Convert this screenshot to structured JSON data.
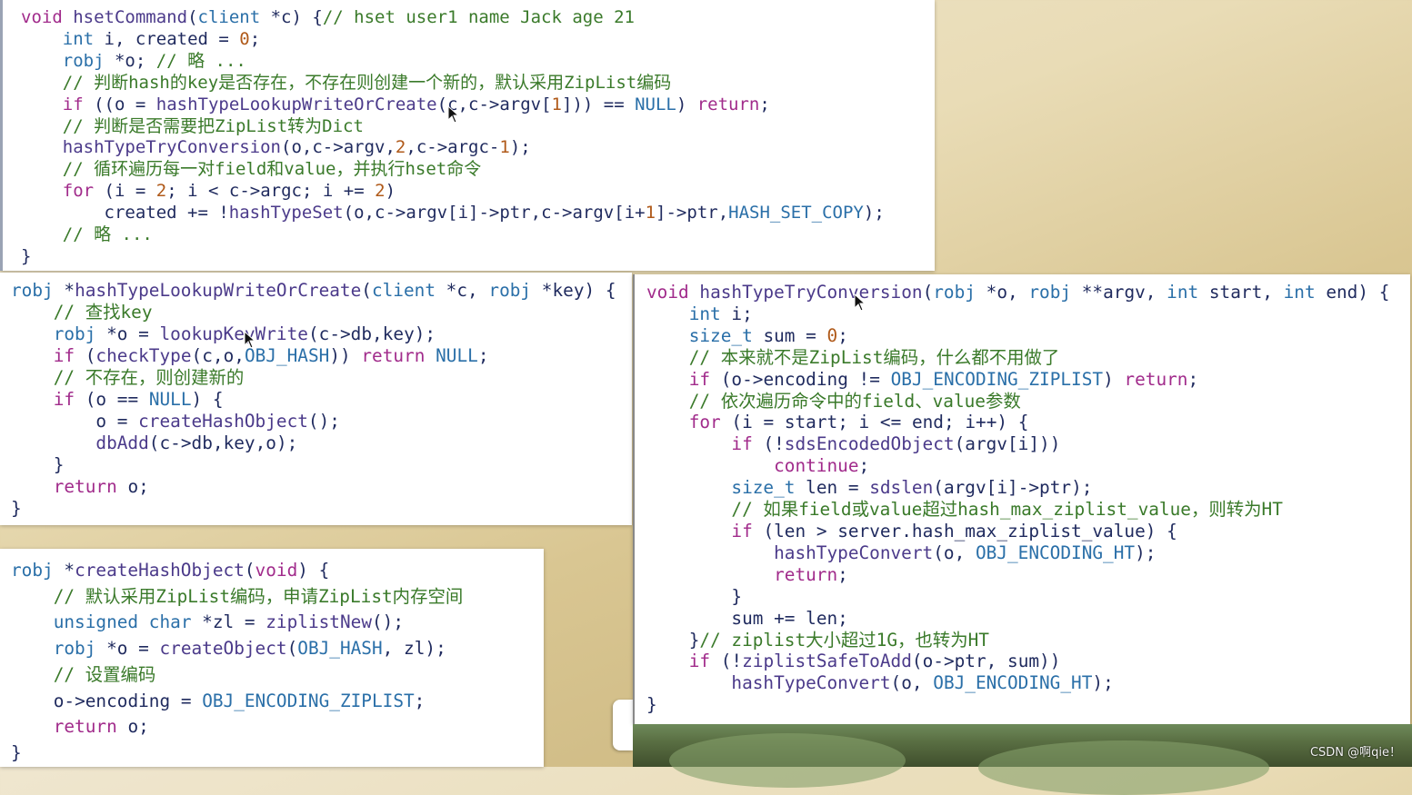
{
  "panels": {
    "hsetCommand": [
      "void hsetCommand(client *c) {// hset user1 name Jack age 21",
      "    int i, created = 0;",
      "    robj *o; // 略 ...",
      "    // 判断hash的key是否存在，不存在则创建一个新的，默认采用ZipList编码",
      "    if ((o = hashTypeLookupWriteOrCreate(c,c->argv[1])) == NULL) return;",
      "    // 判断是否需要把ZipList转为Dict",
      "    hashTypeTryConversion(o,c->argv,2,c->argc-1);",
      "    // 循环遍历每一对field和value，并执行hset命令",
      "    for (i = 2; i < c->argc; i += 2)",
      "        created += !hashTypeSet(o,c->argv[i]->ptr,c->argv[i+1]->ptr,HASH_SET_COPY);",
      "    // 略 ...",
      "}"
    ],
    "lookupWriteOrCreate": [
      "robj *hashTypeLookupWriteOrCreate(client *c, robj *key) {",
      "    // 查找key",
      "    robj *o = lookupKeyWrite(c->db,key);",
      "    if (checkType(c,o,OBJ_HASH)) return NULL;",
      "    // 不存在，则创建新的",
      "    if (o == NULL) {",
      "        o = createHashObject();",
      "        dbAdd(c->db,key,o);",
      "    }",
      "    return o;",
      "}"
    ],
    "createHashObject": [
      "robj *createHashObject(void) {",
      "    // 默认采用ZipList编码，申请ZipList内存空间",
      "    unsigned char *zl = ziplistNew();",
      "    robj *o = createObject(OBJ_HASH, zl);",
      "    // 设置编码",
      "    o->encoding = OBJ_ENCODING_ZIPLIST;",
      "    return o;",
      "}"
    ],
    "tryConversion": [
      "void hashTypeTryConversion(robj *o, robj **argv, int start, int end) {",
      "    int i;",
      "    size_t sum = 0;",
      "    // 本来就不是ZipList编码，什么都不用做了",
      "    if (o->encoding != OBJ_ENCODING_ZIPLIST) return;",
      "    // 依次遍历命令中的field、value参数",
      "    for (i = start; i <= end; i++) {",
      "        if (!sdsEncodedObject(argv[i]))",
      "            continue;",
      "        size_t len = sdslen(argv[i]->ptr);",
      "        // 如果field或value超过hash_max_ziplist_value，则转为HT",
      "        if (len > server.hash_max_ziplist_value) {",
      "            hashTypeConvert(o, OBJ_ENCODING_HT);",
      "            return;",
      "        }",
      "        sum += len;",
      "    }// ziplist大小超过1G，也转为HT",
      "    if (!ziplistSafeToAdd(o->ptr, sum))",
      "        hashTypeConvert(o, OBJ_ENCODING_HT);",
      "}"
    ]
  },
  "watermark": "CSDN @啊qie！",
  "colors": {
    "keyword": "#a12b8b",
    "type": "#2a6fa8",
    "number": "#b05a1a",
    "comment": "#3a7a2a",
    "function": "#4b3a8a",
    "plain": "#1f2a5e"
  }
}
